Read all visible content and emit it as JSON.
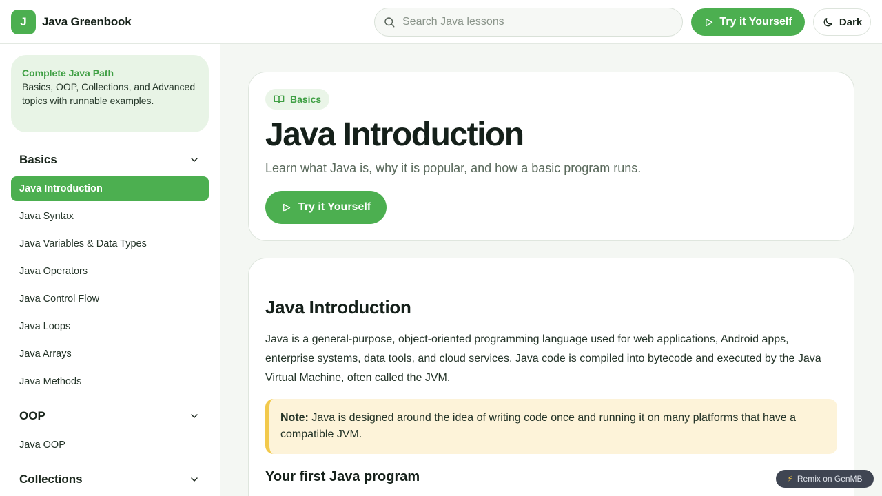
{
  "brand": {
    "logo_letter": "J",
    "name": "Java Greenbook"
  },
  "search": {
    "placeholder": "Search Java lessons",
    "value": ""
  },
  "header": {
    "try_label": "Try it Yourself",
    "theme_label": "Dark"
  },
  "colors": {
    "accent": "#4caf50",
    "note_bar": "#f2c94c",
    "note_bg": "#fdf3d9"
  },
  "sidebar": {
    "path_card": {
      "title": "Complete Java Path",
      "description": "Basics, OOP, Collections, and Advanced topics with runnable examples."
    },
    "groups": [
      {
        "label": "Basics",
        "items": [
          {
            "label": "Java Introduction",
            "active": true
          },
          {
            "label": "Java Syntax"
          },
          {
            "label": "Java Variables & Data Types"
          },
          {
            "label": "Java Operators"
          },
          {
            "label": "Java Control Flow"
          },
          {
            "label": "Java Loops"
          },
          {
            "label": "Java Arrays"
          },
          {
            "label": "Java Methods"
          }
        ]
      },
      {
        "label": "OOP",
        "items": [
          {
            "label": "Java OOP"
          }
        ]
      },
      {
        "label": "Collections",
        "items": []
      }
    ]
  },
  "hero": {
    "badge": "Basics",
    "title": "Java Introduction",
    "subtitle": "Learn what Java is, why it is popular, and how a basic program runs.",
    "try_label": "Try it Yourself"
  },
  "content": {
    "title": "Java Introduction",
    "paragraph": "Java is a general-purpose, object-oriented programming language used for web applications, Android apps, enterprise systems, data tools, and cloud services. Java code is compiled into bytecode and executed by the Java Virtual Machine, often called the JVM.",
    "note_label": "Note:",
    "note_text": " Java is designed around the idea of writing code once and running it on many platforms that have a compatible JVM.",
    "subheading": "Your first Java program"
  },
  "remix": {
    "label": "Remix on GenMB"
  }
}
